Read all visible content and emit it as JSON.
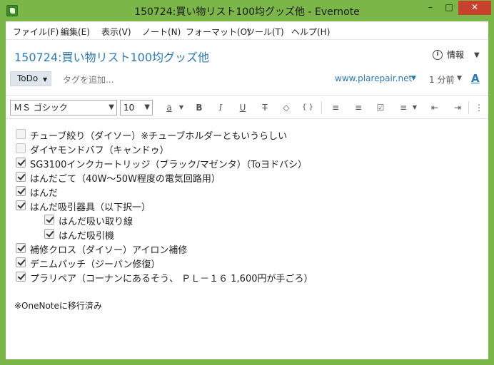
{
  "window": {
    "title": "150724:買い物リスト100均グッズ他 - Evernote",
    "minimize": "–",
    "maximize": "□",
    "close": "✕"
  },
  "menu": [
    "ファイル(F)",
    "編集(E)",
    "表示(V)",
    "ノート(N)",
    "フォーマット(O)",
    "ツール(T)",
    "ヘルプ(H)"
  ],
  "note": {
    "title": "150724:買い物リスト100均グッズ他",
    "info_label": "情報",
    "notebook": "ToDo",
    "tag_placeholder": "タグを追加...",
    "source_url": "www.plarepair.net",
    "time": "1 分前"
  },
  "toolbar": {
    "font": "ＭＳ ゴシック",
    "size": "10",
    "buttons": [
      "a",
      "B",
      "I",
      "U",
      "T",
      "◇",
      "{ }",
      "≡",
      "≡",
      "☑",
      "≡",
      "⇤",
      "⇥"
    ]
  },
  "todos": [
    {
      "text": "チューブ絞り（ダイソー）※チューブホルダーともいうらしい",
      "checked": false,
      "indent": 0
    },
    {
      "text": "ダイヤモンドバフ（キャンドゥ）",
      "checked": false,
      "indent": 0
    },
    {
      "text": "SG3100インクカートリッジ（ブラック/マゼンタ）（Toヨドバシ）",
      "checked": true,
      "indent": 0
    },
    {
      "text": "はんだごて（40W〜50W程度の電気回路用）",
      "checked": true,
      "indent": 0
    },
    {
      "text": "はんだ",
      "checked": true,
      "indent": 0
    },
    {
      "text": "はんだ吸引器具（以下択一）",
      "checked": true,
      "indent": 0
    },
    {
      "text": "はんだ吸い取り線",
      "checked": true,
      "indent": 1
    },
    {
      "text": "はんだ吸引機",
      "checked": true,
      "indent": 1
    },
    {
      "text": "補修クロス（ダイソー）アイロン補修",
      "checked": true,
      "indent": 0
    },
    {
      "text": "デニムパッチ（ジーパン修復）",
      "checked": true,
      "indent": 0
    },
    {
      "text": "プラリペア（コーナンにあるそう、 ＰＬ－１６ 1,600円が手ごろ）",
      "checked": true,
      "indent": 0
    }
  ],
  "footer_text": "※OneNoteに移行済み"
}
